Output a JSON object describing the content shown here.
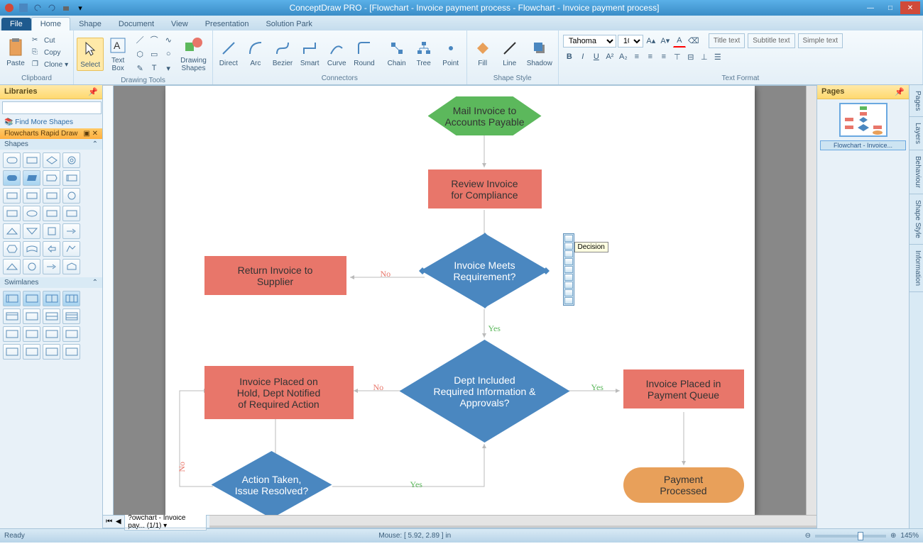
{
  "app": {
    "title": "ConceptDraw PRO - [Flowchart - Invoice payment process - Flowchart - Invoice payment process]"
  },
  "qat": {
    "items": [
      "save",
      "undo",
      "redo",
      "print",
      "copy",
      "paste"
    ]
  },
  "tabs": [
    "File",
    "Home",
    "Shape",
    "Document",
    "View",
    "Presentation",
    "Solution Park"
  ],
  "active_tab": "Home",
  "ribbon": {
    "clipboard": {
      "label": "Clipboard",
      "paste": "Paste",
      "cut": "Cut",
      "copy": "Copy",
      "clone": "Clone"
    },
    "drawing": {
      "label": "Drawing Tools",
      "select": "Select",
      "textbox": "Text\nBox",
      "shapes": "Drawing\nShapes"
    },
    "connectors": {
      "label": "Connectors",
      "direct": "Direct",
      "arc": "Arc",
      "bezier": "Bezier",
      "smart": "Smart",
      "curve": "Curve",
      "round": "Round",
      "chain": "Chain",
      "tree": "Tree",
      "point": "Point"
    },
    "shapestyle": {
      "label": "Shape Style",
      "fill": "Fill",
      "line": "Line",
      "shadow": "Shadow"
    },
    "textformat": {
      "label": "Text Format",
      "font": "Tahoma",
      "size": "10",
      "title": "Title text",
      "subtitle": "Subtitle text",
      "simple": "Simple text"
    }
  },
  "libraries": {
    "title": "Libraries",
    "find_more": "Find More Shapes",
    "section": "Flowcharts Rapid Draw",
    "shapes_label": "Shapes",
    "swimlanes_label": "Swimlanes"
  },
  "pages_panel": {
    "title": "Pages",
    "thumb_label": "Flowchart - Invoice..."
  },
  "vtabs": [
    "Pages",
    "Layers",
    "Behaviour",
    "Shape Style",
    "Information"
  ],
  "canvas": {
    "page_tab": "?owchart - Invoice pay...",
    "page_counter": "(1/1)",
    "tooltip": "Decision",
    "nodes": {
      "start": "Mail Invoice to\nAccounts Payable",
      "review": "Review Invoice\nfor Compliance",
      "meets": "Invoice Meets\nRequirement?",
      "return": "Return Invoice to\nSupplier",
      "dept": "Dept Included\nRequired Information &\nApprovals?",
      "hold": "Invoice Placed on\nHold, Dept Notified\nof Required Action",
      "queue": "Invoice Placed in\nPayment Queue",
      "action": "Action Taken,\nIssue Resolved?",
      "processed": "Payment\nProcessed"
    },
    "labels": {
      "yes": "Yes",
      "no": "No"
    }
  },
  "statusbar": {
    "ready": "Ready",
    "mouse": "Mouse: [ 5.92, 2.89 ] in",
    "zoom": "145%"
  },
  "chart_data": {
    "type": "flowchart",
    "title": "Invoice payment process",
    "nodes": [
      {
        "id": "start",
        "type": "hexagon",
        "label": "Mail Invoice to Accounts Payable",
        "fill": "#5cb85c"
      },
      {
        "id": "review",
        "type": "process",
        "label": "Review Invoice for Compliance",
        "fill": "#e8766a"
      },
      {
        "id": "meets",
        "type": "decision",
        "label": "Invoice Meets Requirement?",
        "fill": "#4a87c0"
      },
      {
        "id": "return",
        "type": "process",
        "label": "Return Invoice to Supplier",
        "fill": "#e8766a"
      },
      {
        "id": "dept",
        "type": "decision",
        "label": "Dept Included Required Information & Approvals?",
        "fill": "#4a87c0"
      },
      {
        "id": "hold",
        "type": "process",
        "label": "Invoice Placed on Hold, Dept Notified of Required Action",
        "fill": "#e8766a"
      },
      {
        "id": "queue",
        "type": "process",
        "label": "Invoice Placed in Payment Queue",
        "fill": "#e8766a"
      },
      {
        "id": "action",
        "type": "decision",
        "label": "Action Taken, Issue Resolved?",
        "fill": "#4a87c0"
      },
      {
        "id": "processed",
        "type": "terminator",
        "label": "Payment Processed",
        "fill": "#e8a05a"
      }
    ],
    "edges": [
      {
        "from": "start",
        "to": "review"
      },
      {
        "from": "review",
        "to": "meets"
      },
      {
        "from": "meets",
        "to": "return",
        "label": "No"
      },
      {
        "from": "meets",
        "to": "dept",
        "label": "Yes"
      },
      {
        "from": "dept",
        "to": "hold",
        "label": "No"
      },
      {
        "from": "dept",
        "to": "queue",
        "label": "Yes"
      },
      {
        "from": "queue",
        "to": "processed"
      },
      {
        "from": "hold",
        "to": "action"
      },
      {
        "from": "action",
        "to": "dept",
        "label": "Yes"
      },
      {
        "from": "action",
        "to": "hold",
        "label": "No"
      }
    ]
  }
}
